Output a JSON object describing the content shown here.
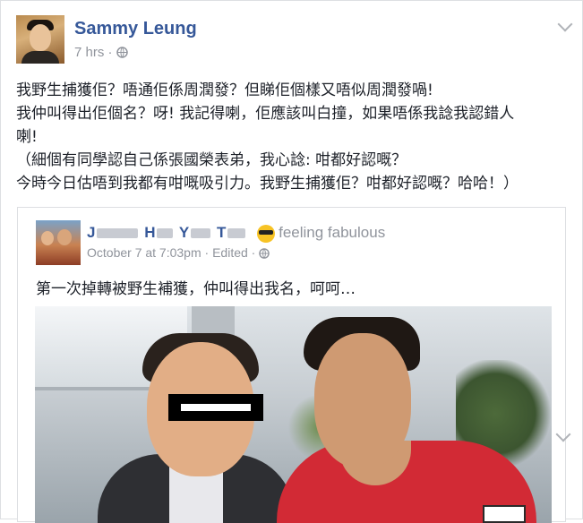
{
  "post": {
    "author": "Sammy Leung",
    "time": "7 hrs",
    "privacy_icon": "globe-icon",
    "body_lines": [
      "我野生捕獲佢？唔通佢係周潤發？但睇佢個樣又唔似周潤發喎!",
      "我仲叫得出佢個名？呀! 我記得喇，佢應該叫白撞，如果唔係我諗我認錯人",
      "喇!",
      "（細個有同學認自己係張國榮表弟，我心諗: 咁都好認嘅？",
      "今時今日估唔到我都有咁嘅吸引力。我野生捕獲佢？咁都好認嘅？哈哈！）"
    ]
  },
  "shared": {
    "name_initials": [
      "J",
      "H",
      "Y",
      "T"
    ],
    "feeling": "feeling fabulous",
    "date": "October 7 at 7:03pm",
    "edited": "Edited",
    "text": "第一次掉轉被野生補獲，仲叫得出我名，呵呵…"
  }
}
